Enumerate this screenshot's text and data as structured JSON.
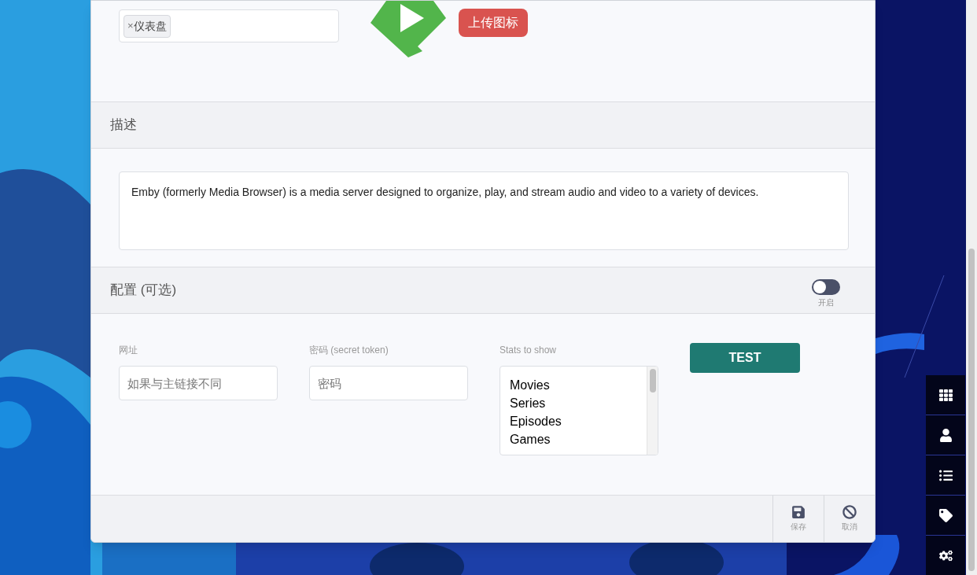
{
  "tags_field": {
    "tags": [
      {
        "remove": "×",
        "label": "仪表盘"
      }
    ]
  },
  "upload_button": "上传图标",
  "description": {
    "heading": "描述",
    "text": "Emby (formerly Media Browser) is a media server designed to organize, play, and stream audio and video to a variety of devices."
  },
  "config": {
    "heading": "配置 (可选)",
    "toggle": {
      "label": "开启",
      "on": false
    },
    "url": {
      "label": "网址",
      "placeholder": "如果与主链接不同"
    },
    "password": {
      "label": "密码 (secret token)",
      "placeholder": "密码"
    },
    "stats": {
      "label": "Stats to show",
      "options": [
        "Movies",
        "Series",
        "Episodes",
        "Games"
      ]
    },
    "test_button": "TEST"
  },
  "footer": [
    {
      "kind": "save",
      "label": "保存"
    },
    {
      "kind": "cancel",
      "label": "取消"
    }
  ],
  "sidebar": [
    {
      "kind": "grid"
    },
    {
      "kind": "user"
    },
    {
      "kind": "list"
    },
    {
      "kind": "tag"
    },
    {
      "kind": "settings"
    }
  ]
}
